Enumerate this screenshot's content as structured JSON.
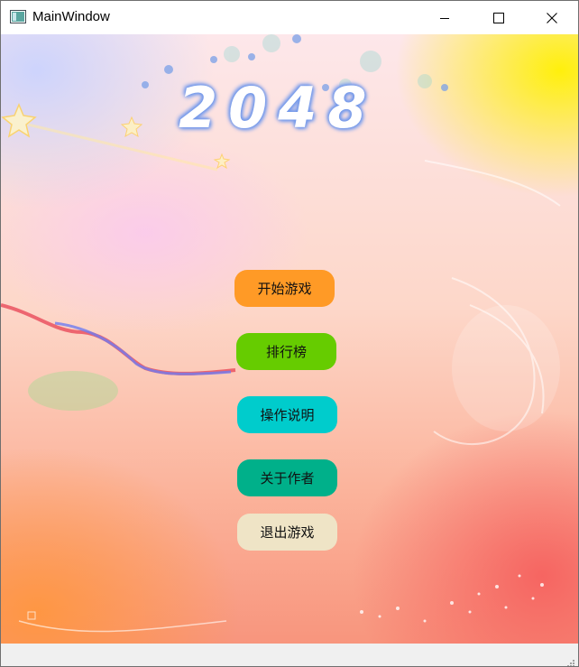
{
  "window": {
    "title": "MainWindow",
    "icon": "app-window-icon",
    "controls": {
      "minimize_icon": "minimize-icon",
      "maximize_icon": "maximize-icon",
      "close_icon": "close-icon"
    }
  },
  "game": {
    "logo_text": "2048"
  },
  "menu": {
    "buttons": [
      {
        "label": "开始游戏",
        "color": "#ff9a26"
      },
      {
        "label": "排行榜",
        "color": "#66cc00"
      },
      {
        "label": "操作说明",
        "color": "#00cccc"
      },
      {
        "label": "关于作者",
        "color": "#00b08a"
      },
      {
        "label": "退出游戏",
        "color": "#efe4c6"
      }
    ]
  },
  "colors": {
    "logo_glow": "#6f95e8",
    "statusbar": "#f0f0f0"
  }
}
